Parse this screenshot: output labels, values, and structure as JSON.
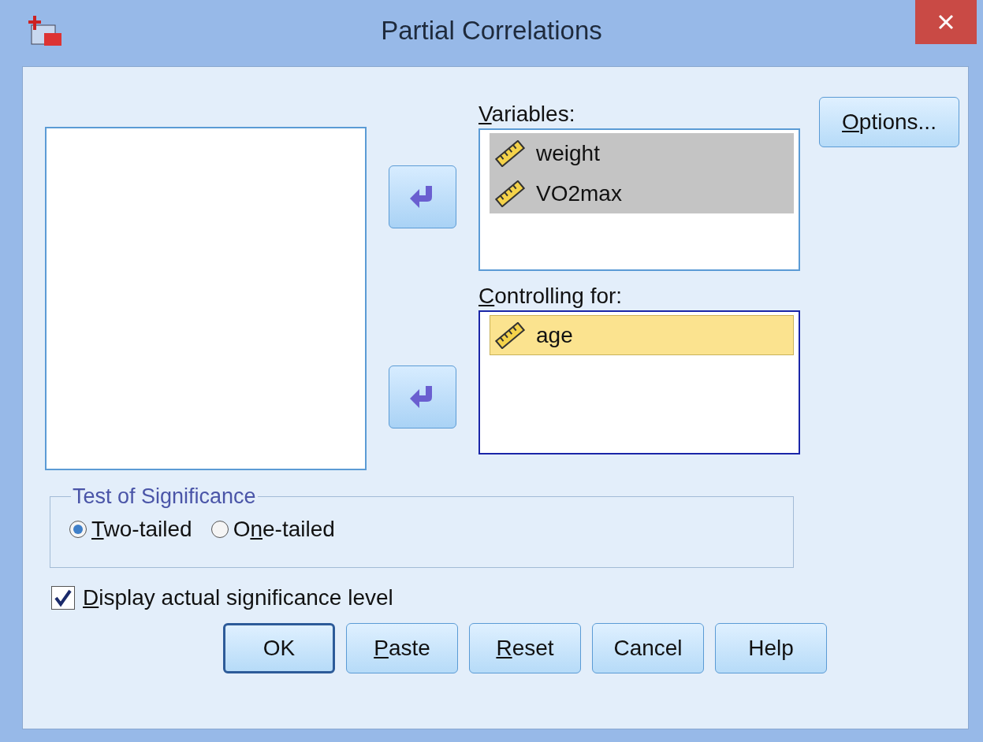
{
  "window": {
    "title": "Partial Correlations"
  },
  "source_list": {
    "focused": false
  },
  "variables": {
    "label": {
      "key": "V",
      "after": "ariables:"
    },
    "focused": false,
    "items": [
      {
        "name": "weight",
        "selected": true
      },
      {
        "name": "VO2max",
        "selected": true
      }
    ]
  },
  "controlling": {
    "label": {
      "key": "C",
      "after": "ontrolling for:"
    },
    "focused": true,
    "items": [
      {
        "name": "age",
        "selected": true
      }
    ]
  },
  "options_button": {
    "key": "O",
    "after": "ptions..."
  },
  "significance": {
    "title": "Test of Significance",
    "options": [
      {
        "label": {
          "key": "T",
          "after": "wo-tailed"
        },
        "selected": true
      },
      {
        "label": {
          "before": "O",
          "key": "n",
          "after": "e-tailed"
        },
        "selected": false
      }
    ]
  },
  "display_checkbox": {
    "label": {
      "key": "D",
      "after": "isplay actual significance level"
    },
    "checked": true
  },
  "buttons": [
    {
      "label": {
        "before": "OK"
      },
      "default": true
    },
    {
      "label": {
        "key": "P",
        "after": "aste"
      },
      "default": false
    },
    {
      "label": {
        "key": "R",
        "after": "eset"
      },
      "default": false
    },
    {
      "label": {
        "before": "Cancel"
      },
      "default": false
    },
    {
      "label": {
        "before": "Help"
      },
      "default": false
    }
  ]
}
